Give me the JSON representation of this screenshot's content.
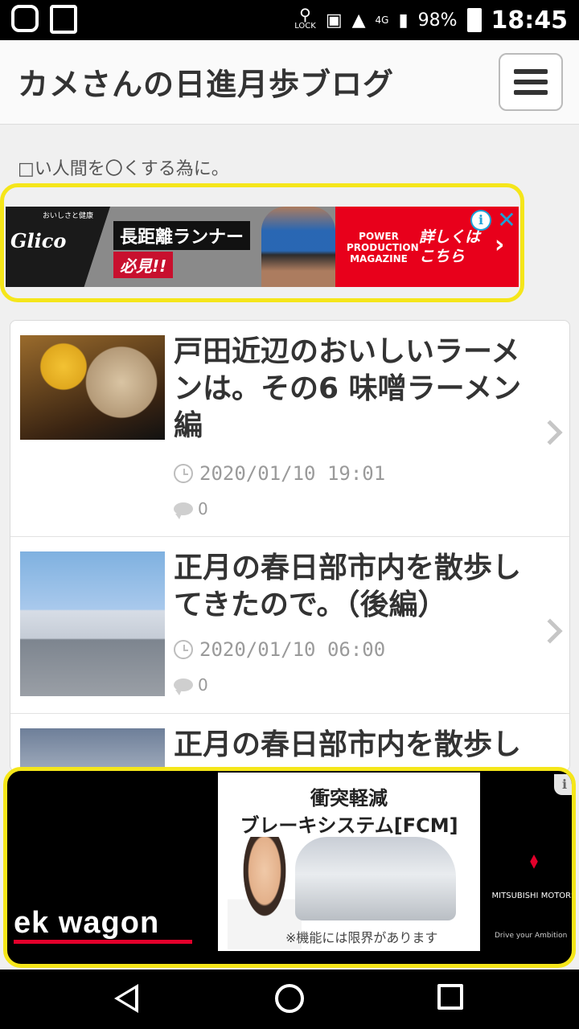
{
  "status_bar": {
    "battery_percent": "98%",
    "network": "4G",
    "lock_label": "LOCK",
    "time": "18:45"
  },
  "header": {
    "site_title": "カメさんの日進月歩ブログ",
    "menu_icon": "hamburger-icon"
  },
  "tagline": "□い人間を〇くする為に。",
  "top_ad": {
    "brand": "Glico",
    "brand_small": "おいしさと健康",
    "headline": "長距離ランナー",
    "sub": "必見!!",
    "magazine": "POWER PRODUCTION MAGAZINE",
    "cta": "詳しくは こちら",
    "info_icon": "info-icon",
    "close_icon": "close-icon"
  },
  "posts": [
    {
      "title": "戸田近辺のおいしいラーメンは。その6 味噌ラーメン編",
      "date": "2020/01/10 19:01",
      "comments": "0"
    },
    {
      "title": "正月の春日部市内を散歩してきたので。（後編）",
      "date": "2020/01/10 06:00",
      "comments": "0"
    },
    {
      "title": "正月の春日部市内を散歩し",
      "date": "",
      "comments": ""
    }
  ],
  "bottom_ad": {
    "product": "ek wagon",
    "headline1": "衝突軽減",
    "headline2": "ブレーキシステム[FCM]",
    "note": "※機能には限界があります",
    "maker": "MITSUBISHI MOTORS",
    "tagline": "Drive your Ambition",
    "choice_icon": "adchoices-icon"
  },
  "nav_bar": {
    "back": "back-icon",
    "home": "home-icon",
    "recents": "recents-icon"
  }
}
